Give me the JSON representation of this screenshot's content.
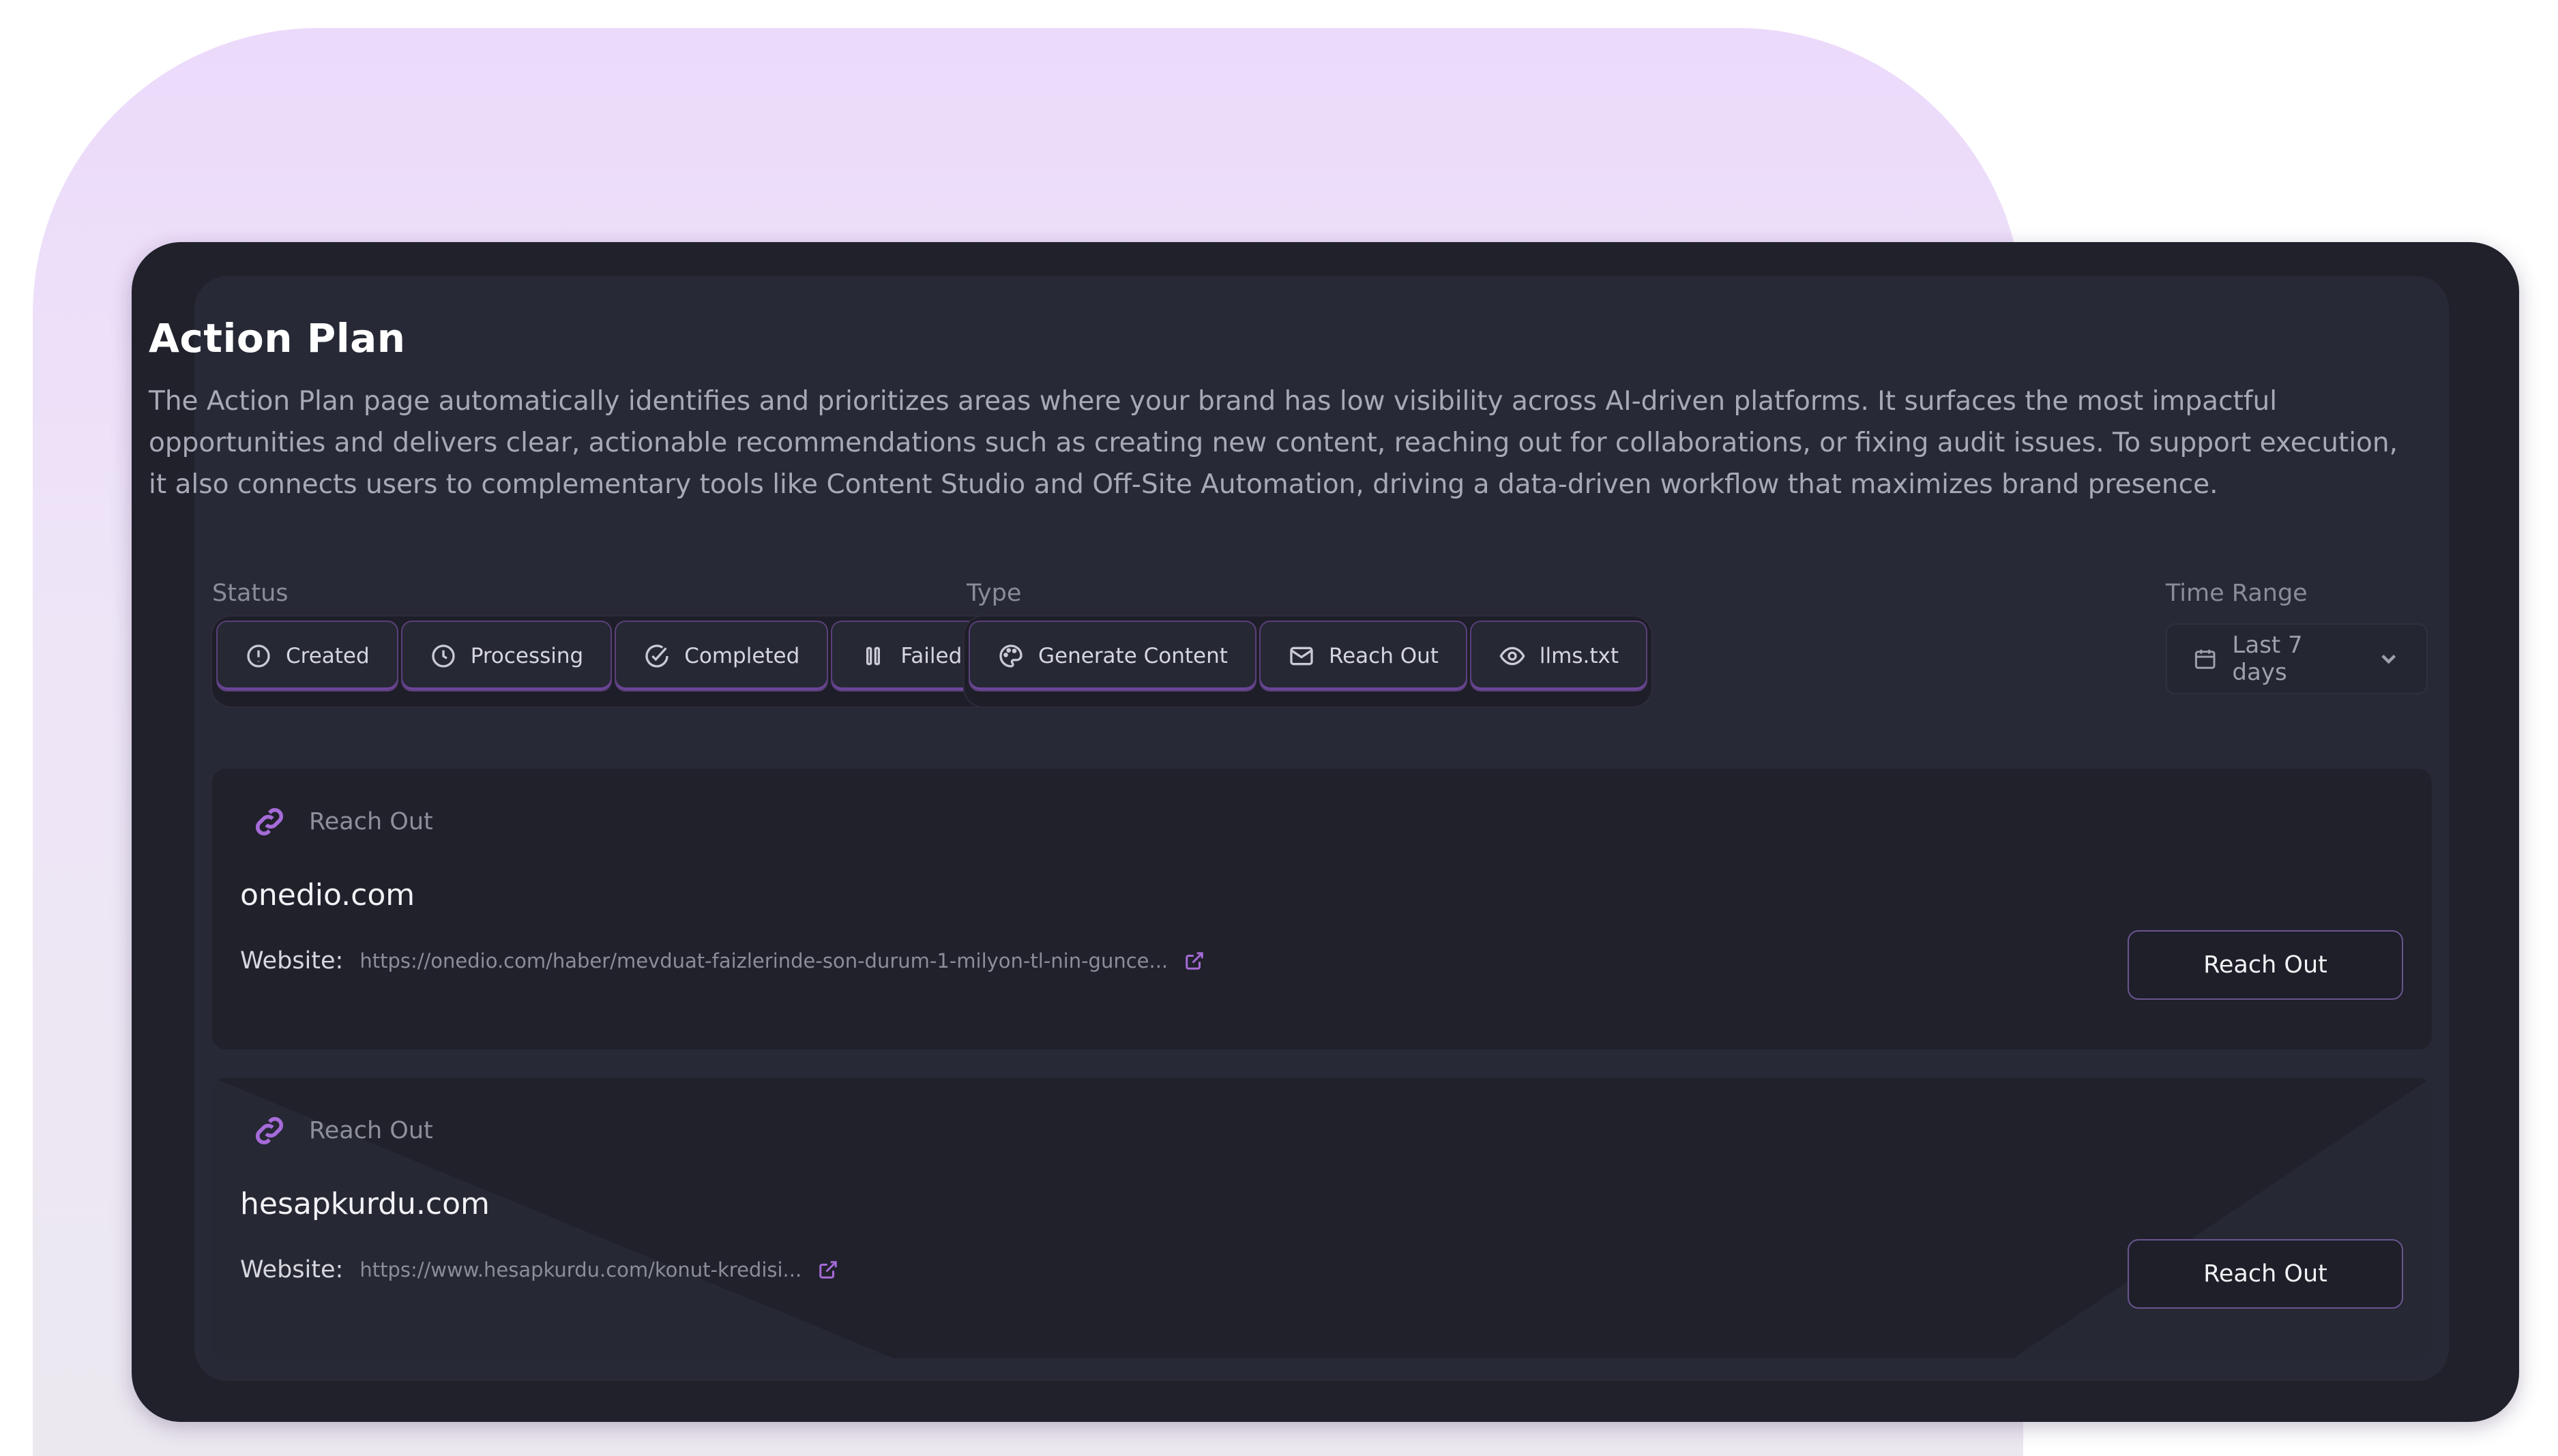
{
  "page": {
    "title": "Action Plan",
    "description": "The Action Plan page automatically identifies and prioritizes areas where your brand has low visibility across AI-driven platforms. It surfaces the most impactful opportunities and delivers clear, actionable recommendations such as creating new content, reaching out for collaborations, or fixing audit issues. To support execution, it also connects users to complementary tools like Content Studio and Off-Site Automation, driving a data-driven workflow that maximizes brand presence."
  },
  "filters": {
    "status_label": "Status",
    "status_options": [
      {
        "label": "Created",
        "icon": "alert-circle-icon"
      },
      {
        "label": "Processing",
        "icon": "clock-icon"
      },
      {
        "label": "Completed",
        "icon": "check-circle-icon"
      },
      {
        "label": "Failed",
        "icon": "pause-icon"
      }
    ],
    "type_label": "Type",
    "type_options": [
      {
        "label": "Generate Content",
        "icon": "palette-icon"
      },
      {
        "label": "Reach Out",
        "icon": "mail-icon"
      },
      {
        "label": "llms.txt",
        "icon": "eye-icon"
      }
    ],
    "time_range_label": "Time Range",
    "time_range_value": "Last 7 days"
  },
  "cards": [
    {
      "type": "Reach Out",
      "domain": "onedio.com",
      "website_label": "Website:",
      "url": "https://onedio.com/haber/mevduat-faizlerinde-son-durum-1-milyon-tl-nin-gunce...",
      "button_label": "Reach Out"
    },
    {
      "type": "Reach Out",
      "domain": "hesapkurdu.com",
      "website_label": "Website:",
      "url": "https://www.hesapkurdu.com/konut-kredisi...",
      "button_label": "Reach Out"
    }
  ],
  "colors": {
    "accent": "#a56bd8",
    "window_bg": "#20212b",
    "panel_bg": "#272a36"
  }
}
